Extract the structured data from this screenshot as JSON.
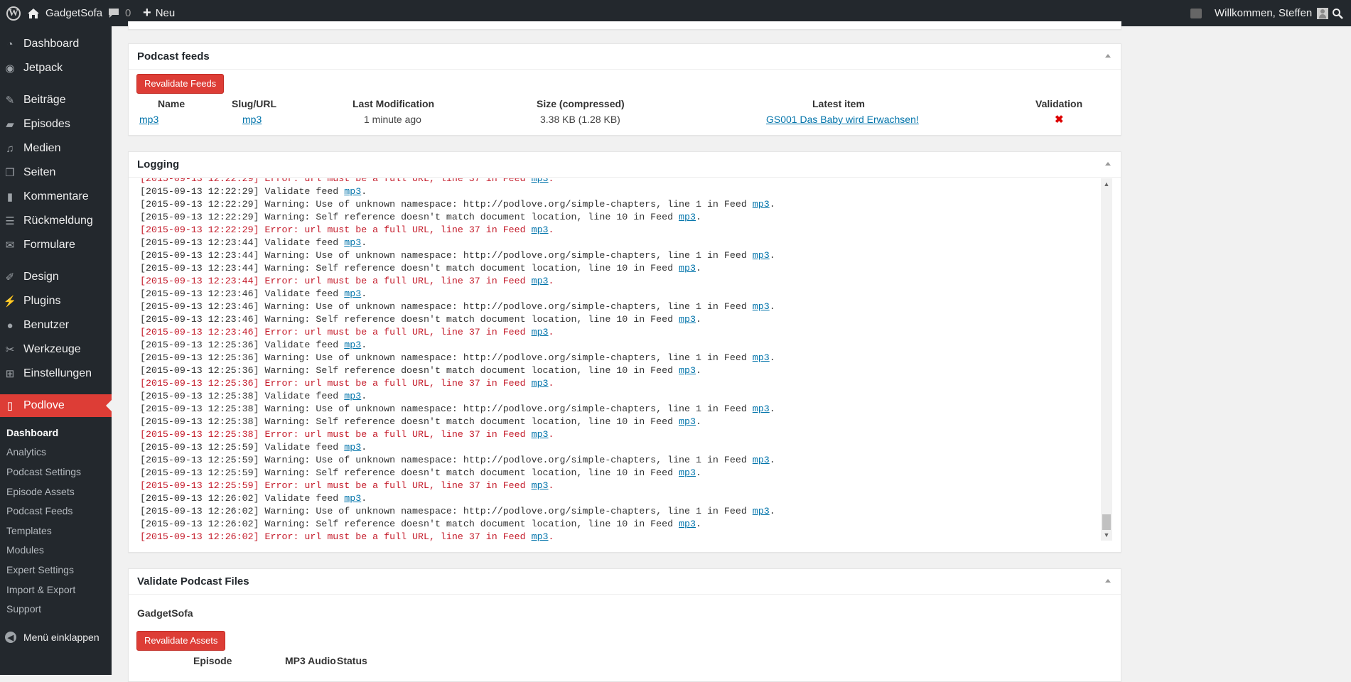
{
  "adminbar": {
    "site_name": "GadgetSofa",
    "comments_count": "0",
    "new_label": "Neu",
    "welcome": "Willkommen, Steffen"
  },
  "sidebar": {
    "items": [
      {
        "label": "Dashboard",
        "icon": "dashboard-icon"
      },
      {
        "label": "Jetpack",
        "icon": "jetpack-icon"
      },
      {
        "label": "Beiträge",
        "icon": "pin-icon"
      },
      {
        "label": "Episodes",
        "icon": "clapper-icon"
      },
      {
        "label": "Medien",
        "icon": "media-icon"
      },
      {
        "label": "Seiten",
        "icon": "pages-icon"
      },
      {
        "label": "Kommentare",
        "icon": "comment-icon"
      },
      {
        "label": "Rückmeldung",
        "icon": "feedback-icon"
      },
      {
        "label": "Formulare",
        "icon": "mail-icon"
      },
      {
        "label": "Design",
        "icon": "brush-icon"
      },
      {
        "label": "Plugins",
        "icon": "plugin-icon"
      },
      {
        "label": "Benutzer",
        "icon": "user-icon"
      },
      {
        "label": "Werkzeuge",
        "icon": "wrench-icon"
      },
      {
        "label": "Einstellungen",
        "icon": "settings-icon"
      },
      {
        "label": "Podlove",
        "icon": "podlove-icon"
      }
    ],
    "submenu": [
      "Dashboard",
      "Analytics",
      "Podcast Settings",
      "Episode Assets",
      "Podcast Feeds",
      "Templates",
      "Modules",
      "Expert Settings",
      "Import & Export",
      "Support"
    ],
    "collapse_label": "Menü einklappen"
  },
  "feeds": {
    "title": "Podcast feeds",
    "revalidate_button": "Revalidate Feeds",
    "columns": [
      "Name",
      "Slug/URL",
      "Last Modification",
      "Size (compressed)",
      "Latest item",
      "Validation"
    ],
    "row": {
      "name": "mp3",
      "slug": "mp3",
      "last_modification": "1 minute ago",
      "size": "3.38 KB (1.28 KB)",
      "latest_item": "GS001 Das Baby wird Erwachsen!",
      "validation": "✖"
    }
  },
  "logging": {
    "title": "Logging",
    "lines": [
      {
        "time": "[2015-09-13 12:22:29]",
        "text": " Validate feed ",
        "error": false
      },
      {
        "time": "[2015-09-13 12:22:29]",
        "text": " Warning: Use of unknown namespace: http://podlove.org/simple-chapters, line 1 in Feed ",
        "error": false
      },
      {
        "time": "[2015-09-13 12:22:29]",
        "text": " Warning: Self reference doesn't match document location, line 10 in Feed ",
        "error": false
      },
      {
        "time": "[2015-09-13 12:22:29]",
        "text": " Error: url must be a full URL, line 37 in Feed ",
        "error": true
      },
      {
        "time": "[2015-09-13 12:23:44]",
        "text": " Validate feed ",
        "error": false
      },
      {
        "time": "[2015-09-13 12:23:44]",
        "text": " Warning: Use of unknown namespace: http://podlove.org/simple-chapters, line 1 in Feed ",
        "error": false
      },
      {
        "time": "[2015-09-13 12:23:44]",
        "text": " Warning: Self reference doesn't match document location, line 10 in Feed ",
        "error": false
      },
      {
        "time": "[2015-09-13 12:23:44]",
        "text": " Error: url must be a full URL, line 37 in Feed ",
        "error": true
      },
      {
        "time": "[2015-09-13 12:23:46]",
        "text": " Validate feed ",
        "error": false
      },
      {
        "time": "[2015-09-13 12:23:46]",
        "text": " Warning: Use of unknown namespace: http://podlove.org/simple-chapters, line 1 in Feed ",
        "error": false
      },
      {
        "time": "[2015-09-13 12:23:46]",
        "text": " Warning: Self reference doesn't match document location, line 10 in Feed ",
        "error": false
      },
      {
        "time": "[2015-09-13 12:23:46]",
        "text": " Error: url must be a full URL, line 37 in Feed ",
        "error": true
      },
      {
        "time": "[2015-09-13 12:25:36]",
        "text": " Validate feed ",
        "error": false
      },
      {
        "time": "[2015-09-13 12:25:36]",
        "text": " Warning: Use of unknown namespace: http://podlove.org/simple-chapters, line 1 in Feed ",
        "error": false
      },
      {
        "time": "[2015-09-13 12:25:36]",
        "text": " Warning: Self reference doesn't match document location, line 10 in Feed ",
        "error": false
      },
      {
        "time": "[2015-09-13 12:25:36]",
        "text": " Error: url must be a full URL, line 37 in Feed ",
        "error": true
      },
      {
        "time": "[2015-09-13 12:25:38]",
        "text": " Validate feed ",
        "error": false
      },
      {
        "time": "[2015-09-13 12:25:38]",
        "text": " Warning: Use of unknown namespace: http://podlove.org/simple-chapters, line 1 in Feed ",
        "error": false
      },
      {
        "time": "[2015-09-13 12:25:38]",
        "text": " Warning: Self reference doesn't match document location, line 10 in Feed ",
        "error": false
      },
      {
        "time": "[2015-09-13 12:25:38]",
        "text": " Error: url must be a full URL, line 37 in Feed ",
        "error": true
      },
      {
        "time": "[2015-09-13 12:25:59]",
        "text": " Validate feed ",
        "error": false
      },
      {
        "time": "[2015-09-13 12:25:59]",
        "text": " Warning: Use of unknown namespace: http://podlove.org/simple-chapters, line 1 in Feed ",
        "error": false
      },
      {
        "time": "[2015-09-13 12:25:59]",
        "text": " Warning: Self reference doesn't match document location, line 10 in Feed ",
        "error": false
      },
      {
        "time": "[2015-09-13 12:25:59]",
        "text": " Error: url must be a full URL, line 37 in Feed ",
        "error": true
      },
      {
        "time": "[2015-09-13 12:26:02]",
        "text": " Validate feed ",
        "error": false
      },
      {
        "time": "[2015-09-13 12:26:02]",
        "text": " Warning: Use of unknown namespace: http://podlove.org/simple-chapters, line 1 in Feed ",
        "error": false
      },
      {
        "time": "[2015-09-13 12:26:02]",
        "text": " Warning: Self reference doesn't match document location, line 10 in Feed ",
        "error": false
      },
      {
        "time": "[2015-09-13 12:26:02]",
        "text": " Error: url must be a full URL, line 37 in Feed ",
        "error": true
      }
    ],
    "feed_link": "mp3",
    "suffix": "."
  },
  "validate_files": {
    "title": "Validate Podcast Files",
    "podcast_name": "GadgetSofa",
    "revalidate_button": "Revalidate Assets",
    "columns": [
      "Episode",
      "MP3 Audio",
      "Status"
    ]
  }
}
